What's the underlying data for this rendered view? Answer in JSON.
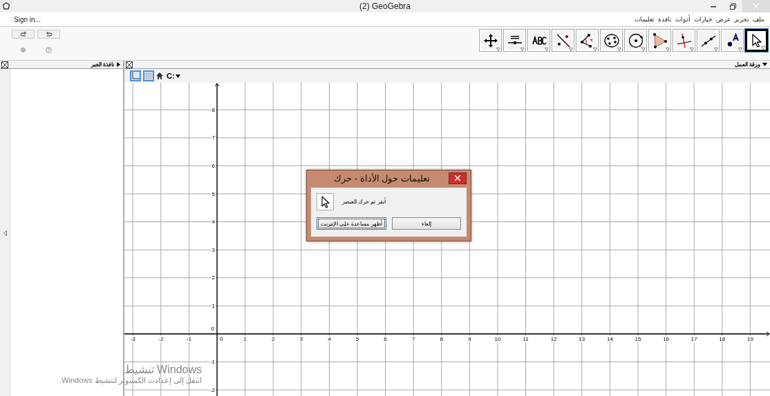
{
  "window": {
    "title": "(2) GeoGebra"
  },
  "menu": {
    "sign_in": "Sign in...",
    "items": [
      "ملف",
      "تحرير",
      "عرض",
      "خيارات",
      "أدوات",
      "نافذة",
      "تعليمات"
    ]
  },
  "toolbar": {
    "tools": [
      {
        "kind": "move-view",
        "selected": false
      },
      {
        "kind": "slider",
        "selected": false
      },
      {
        "kind": "text",
        "selected": false
      },
      {
        "kind": "reflect",
        "selected": false
      },
      {
        "kind": "angle",
        "selected": false
      },
      {
        "kind": "conic",
        "selected": false
      },
      {
        "kind": "circle",
        "selected": false
      },
      {
        "kind": "polygon",
        "selected": false
      },
      {
        "kind": "perpendicular",
        "selected": false
      },
      {
        "kind": "line",
        "selected": false
      },
      {
        "kind": "point",
        "selected": false
      },
      {
        "kind": "pointer",
        "selected": true
      }
    ]
  },
  "algebra_view": {
    "title": "نافذة الجبر"
  },
  "graphics_view": {
    "title": "ورقة العمل",
    "style_bar": {
      "axes_on": true,
      "grid_on": true,
      "point_capture": "C:"
    },
    "x_ticks": [
      "19",
      "18",
      "17",
      "16",
      "15",
      "14",
      "13",
      "12",
      "11",
      "10",
      "9",
      "8",
      "7",
      "6",
      "5",
      "4",
      "3",
      "2",
      "1",
      "0",
      "-1",
      "-2",
      "-3"
    ],
    "y_ticks": [
      "8",
      "7",
      "6",
      "5",
      "4",
      "3",
      "2",
      "1",
      "0",
      "-1",
      "-2"
    ]
  },
  "dialog": {
    "title": "تعليمات حول الأداة - حرك",
    "message": "أنقر ثم حرك العنصر",
    "buttons": [
      {
        "label": "إلغاء",
        "focused": false
      },
      {
        "label": "أظهر مساعدة على الإنترنت",
        "focused": true
      }
    ]
  },
  "activation_notice": {
    "title": "تنشيط Windows",
    "message": "انتقل إلى إعدادت الكمبيوتر لتنشيط Windows."
  }
}
